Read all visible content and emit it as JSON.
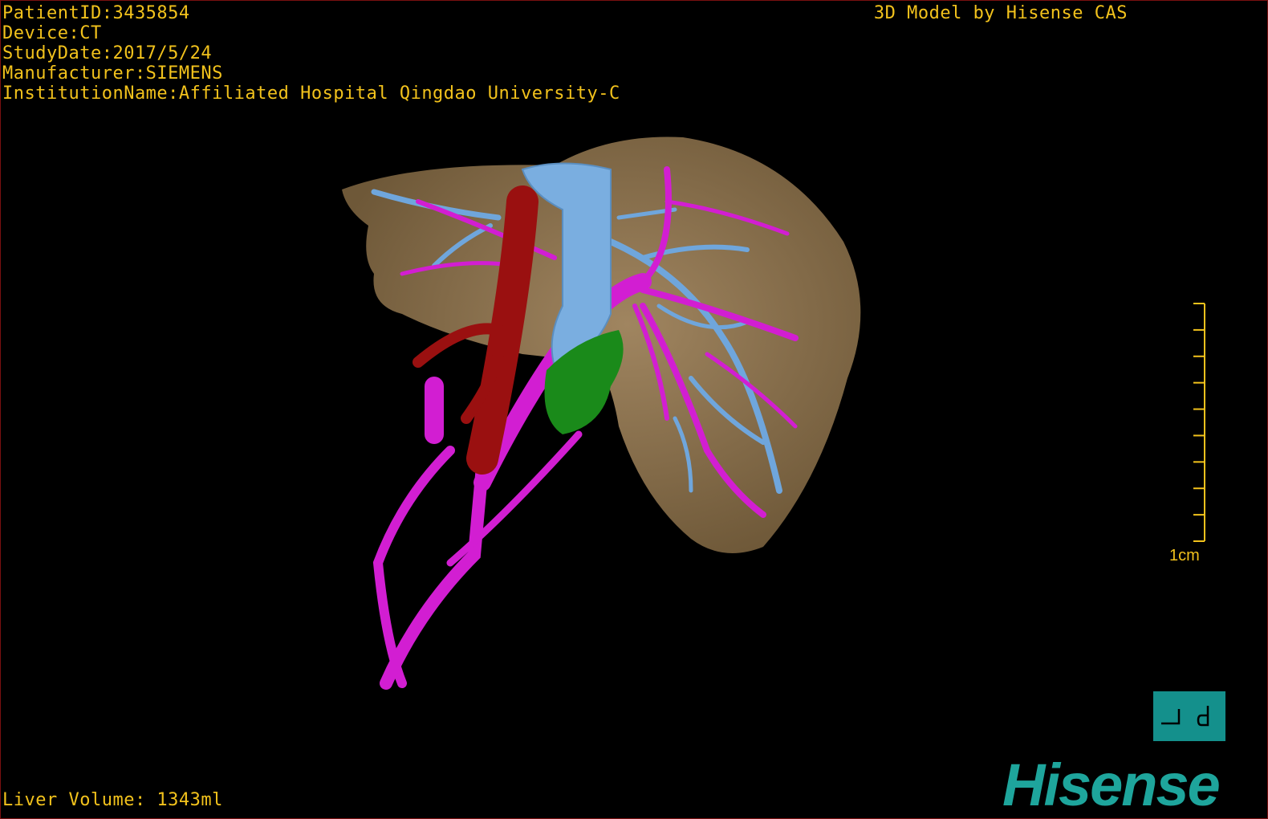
{
  "header": {
    "patient_id": "PatientID:3435854",
    "device": "Device:CT",
    "study_date": "StudyDate:2017/5/24",
    "manufacturer": "Manufacturer:SIEMENS",
    "institution": "InstitutionName:Affiliated Hospital Qingdao University-C",
    "brand": "3D Model by Hisense CAS"
  },
  "footer": {
    "liver_volume": "Liver Volume: 1343ml"
  },
  "scale": {
    "label": "1cm",
    "ticks": 10
  },
  "orientation": {
    "icon": "orientation-cube-icon",
    "left_glyph": "┘",
    "right_glyph": "d"
  },
  "logo": {
    "text": "Hisense"
  },
  "colors": {
    "text": "#f2c21c",
    "liver": "#8f7450",
    "hepatic_vein": "#6fa6dc",
    "portal_vein": "#d21ed2",
    "ivc_artery": "#9a1010",
    "gallbladder": "#1a8a1a",
    "orientation_box": "#14908c",
    "logo": "#1ea59c"
  }
}
